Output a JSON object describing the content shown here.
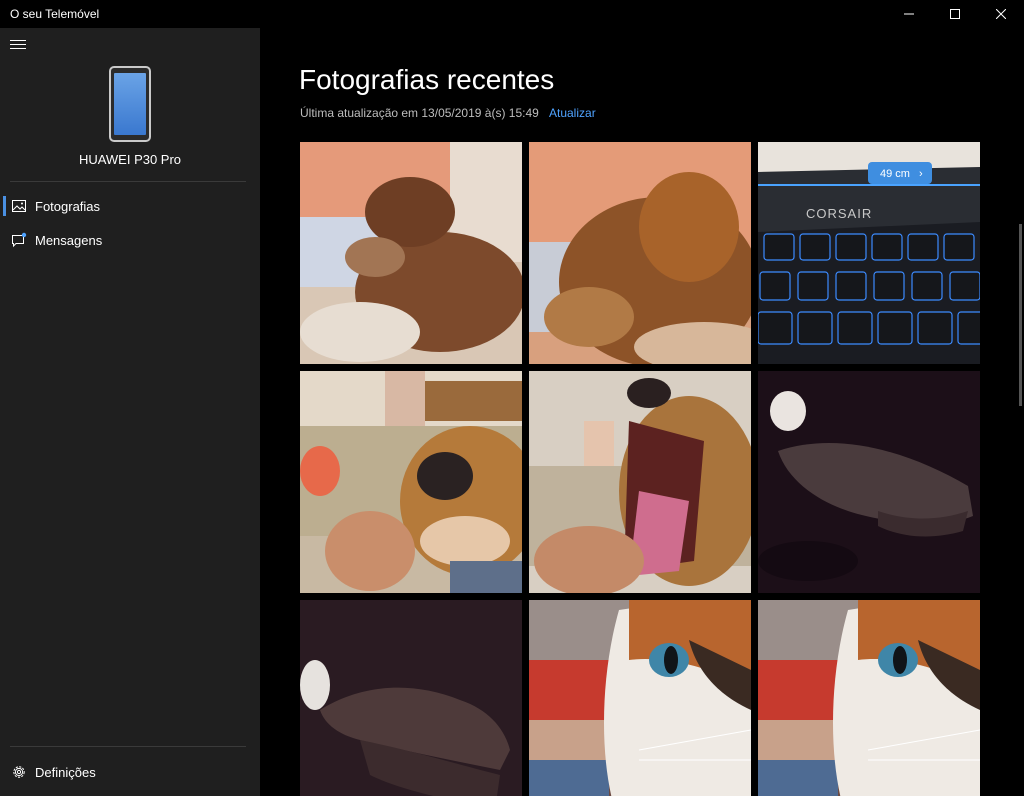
{
  "window": {
    "title": "O seu Telemóvel",
    "controls": [
      "minimize-icon",
      "maximize-icon",
      "close-icon"
    ]
  },
  "sidebar": {
    "menu_icon": "hamburger-icon",
    "device_name": "HUAWEI P30 Pro",
    "items": [
      {
        "label": "Fotografias",
        "icon": "photos-icon",
        "active": true
      },
      {
        "label": "Mensagens",
        "icon": "messages-icon",
        "active": false
      }
    ],
    "settings_label": "Definições",
    "settings_icon": "gear-icon"
  },
  "main": {
    "title": "Fotografias recentes",
    "last_update": "Última atualização em 13/05/2019 à(s) 15:49",
    "refresh_label": "Atualizar",
    "photos": [
      {
        "subject": "dog-sleeping-pillow"
      },
      {
        "subject": "dog-sleeping-closeup"
      },
      {
        "subject": "keyboard",
        "overlay_label": "49 cm",
        "brand_text": "CORSAIR"
      },
      {
        "subject": "dog-face-sofa"
      },
      {
        "subject": "dog-yawning"
      },
      {
        "subject": "hand-dark"
      },
      {
        "subject": "hand-dark-2"
      },
      {
        "subject": "cat-closeup"
      },
      {
        "subject": "cat-closeup-2"
      }
    ]
  },
  "colors": {
    "accent": "#4fa3ff",
    "sidebar_bg": "#1f1f1f",
    "main_bg": "#000000"
  }
}
